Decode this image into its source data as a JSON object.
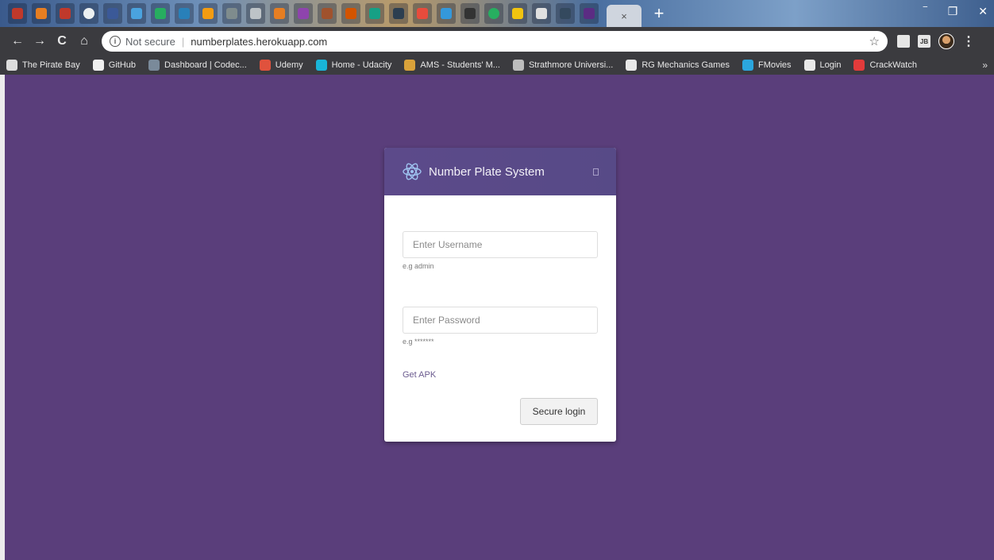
{
  "browser": {
    "active_tab_close": "×",
    "new_tab": "+",
    "window_controls": {
      "minimize": "‾",
      "restore": "❐",
      "close": "✕"
    },
    "toolbar": {
      "back": "←",
      "forward": "→",
      "reload": "C",
      "home": "⌂",
      "menu": "⋮",
      "star": "☆",
      "ext_label": "JB"
    },
    "address": {
      "security_text": "Not secure",
      "url": "numberplates.herokuapp.com"
    },
    "bookmarks": [
      {
        "label": "The Pirate Bay",
        "color": "#dddddd"
      },
      {
        "label": "GitHub",
        "color": "#f0f0f0"
      },
      {
        "label": "Dashboard | Codec...",
        "color": "#7a8a9a"
      },
      {
        "label": "Udemy",
        "color": "#e0523d"
      },
      {
        "label": "Home - Udacity",
        "color": "#19b5d8"
      },
      {
        "label": "AMS - Students' M...",
        "color": "#d9a23a"
      },
      {
        "label": "Strathmore Universi...",
        "color": "#bdbdbd"
      },
      {
        "label": "RG Mechanics Games",
        "color": "#e8e8e8"
      },
      {
        "label": "FMovies",
        "color": "#2ba6de"
      },
      {
        "label": "Login",
        "color": "#e8e8e8"
      },
      {
        "label": "CrackWatch",
        "color": "#e23b3b"
      }
    ],
    "bookmarks_more": "»"
  },
  "login": {
    "title": "Number Plate System",
    "username_placeholder": "Enter Username",
    "username_hint": "e.g admin",
    "password_placeholder": "Enter Password",
    "password_hint": "e.g *******",
    "apk_link": "Get APK",
    "submit_label": "Secure login"
  },
  "colors": {
    "page_bg": "#5a3e7b",
    "header_bg": "#574a87",
    "link": "#6b5b8f"
  }
}
